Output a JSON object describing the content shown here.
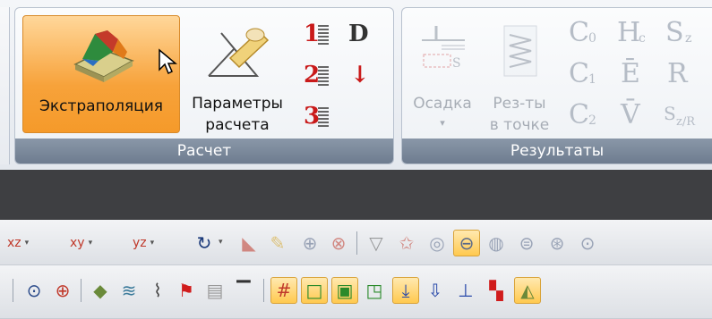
{
  "ribbon": {
    "group_calc": {
      "label": "Расчет",
      "extrapolation_label": "Экстраполяция",
      "params_line1": "Параметры",
      "params_line2": "расчета",
      "small_icons": [
        "1",
        "2",
        "3",
        "D",
        "↓"
      ]
    },
    "group_results": {
      "label": "Результаты",
      "settlement_label": "Осадка",
      "settlement_arrow": "▾",
      "point_line1": "Рез-ты",
      "point_line2": "в точке",
      "symbols": [
        "C",
        "C",
        "C",
        "H",
        "Ē",
        "V̄",
        "S",
        "R",
        "S"
      ],
      "sub_0": "0",
      "sub_1": "1",
      "sub_2": "2",
      "sub_c": "c",
      "sub_z": "z",
      "sub_zr": "z/R"
    }
  },
  "toolbar1": {
    "items": [
      "xz",
      "xy",
      "yz"
    ]
  },
  "colors": {
    "accent_orange": "#f59a2a",
    "group_label_bg": "#7a889a",
    "dark_band": "#3e3f42",
    "red_icon": "#c91a1a"
  }
}
